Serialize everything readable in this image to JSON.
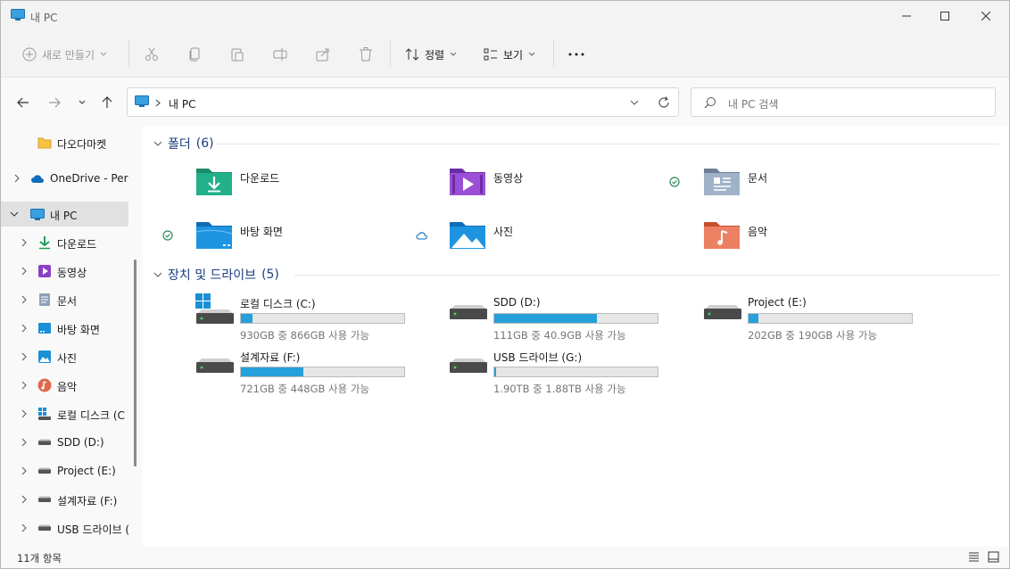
{
  "window": {
    "title": "내 PC"
  },
  "toolbar": {
    "new_label": "새로 만들기",
    "sort_label": "정렬",
    "view_label": "보기",
    "more_label": "..."
  },
  "address": {
    "location": "내 PC"
  },
  "search": {
    "placeholder": "내 PC 검색"
  },
  "sidebar": {
    "items": [
      {
        "label": "다오다마켓"
      },
      {
        "label": "OneDrive - Perso"
      },
      {
        "label": "내 PC"
      },
      {
        "label": "다운로드"
      },
      {
        "label": "동영상"
      },
      {
        "label": "문서"
      },
      {
        "label": "바탕 화면"
      },
      {
        "label": "사진"
      },
      {
        "label": "음악"
      },
      {
        "label": "로컬 디스크 (C"
      },
      {
        "label": "SDD (D:)"
      },
      {
        "label": "Project (E:)"
      },
      {
        "label": "설계자료 (F:)"
      },
      {
        "label": "USB 드라이브 ("
      }
    ]
  },
  "groups": {
    "folders": {
      "title": "폴더",
      "count": "(6)"
    },
    "drives": {
      "title": "장치 및 드라이브",
      "count": "(5)"
    }
  },
  "folders": [
    {
      "label": "다운로드",
      "status": ""
    },
    {
      "label": "동영상",
      "status": ""
    },
    {
      "label": "문서",
      "status": "synced"
    },
    {
      "label": "바탕 화면",
      "status": "synced"
    },
    {
      "label": "사진",
      "status": "cloud"
    },
    {
      "label": "음악",
      "status": ""
    }
  ],
  "drives": [
    {
      "label": "로컬 디스크 (C:)",
      "usage": "930GB 중 866GB 사용 가능",
      "used_fraction": 0.07
    },
    {
      "label": "SDD (D:)",
      "usage": "111GB 중 40.9GB 사용 가능",
      "used_fraction": 0.63
    },
    {
      "label": "Project (E:)",
      "usage": "202GB 중 190GB 사용 가능",
      "used_fraction": 0.06
    },
    {
      "label": "설계자료 (F:)",
      "usage": "721GB 중 448GB 사용 가능",
      "used_fraction": 0.38
    },
    {
      "label": "USB 드라이브 (G:)",
      "usage": "1.90TB 중 1.88TB 사용 가능",
      "used_fraction": 0.01
    }
  ],
  "status": {
    "item_count": "11개 항목"
  },
  "colors": {
    "accent": "#26a0da",
    "header": "#1a3d7c",
    "synced": "#2e8b57"
  }
}
